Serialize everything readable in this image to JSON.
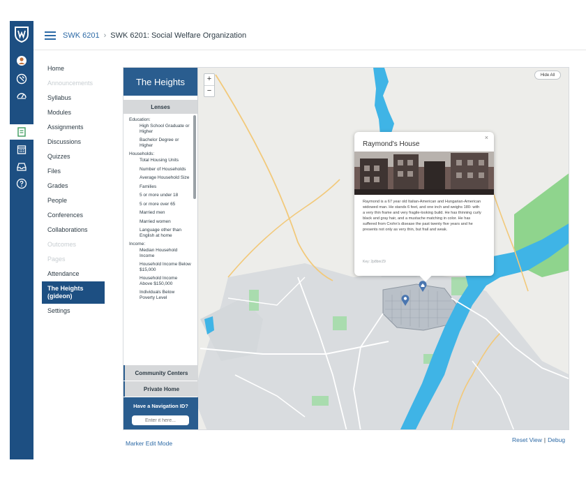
{
  "colors": {
    "brand_blue": "#1d4f82",
    "panel_blue": "#2a5d8f",
    "link_blue": "#2d6aa6",
    "water": "#3fb4e6",
    "park_green": "#8fd48d",
    "pin_blue": "#4a76b0"
  },
  "global_nav": {
    "icons": [
      "university-shield-logo",
      "account-icon",
      "admin-icon",
      "dashboard-icon",
      "courses-icon",
      "calendar-icon",
      "inbox-icon",
      "help-icon"
    ]
  },
  "header": {
    "course_code": "SWK 6201",
    "separator": "›",
    "page_title": "SWK 6201: Social Welfare Organization"
  },
  "course_nav": {
    "items": [
      {
        "label": "Home",
        "state": "normal"
      },
      {
        "label": "Announcements",
        "state": "muted"
      },
      {
        "label": "Syllabus",
        "state": "normal"
      },
      {
        "label": "Modules",
        "state": "normal"
      },
      {
        "label": "Assignments",
        "state": "normal"
      },
      {
        "label": "Discussions",
        "state": "normal"
      },
      {
        "label": "Quizzes",
        "state": "normal"
      },
      {
        "label": "Files",
        "state": "normal"
      },
      {
        "label": "Grades",
        "state": "normal"
      },
      {
        "label": "People",
        "state": "normal"
      },
      {
        "label": "Conferences",
        "state": "normal"
      },
      {
        "label": "Collaborations",
        "state": "normal"
      },
      {
        "label": "Outcomes",
        "state": "muted"
      },
      {
        "label": "Pages",
        "state": "muted"
      },
      {
        "label": "Attendance",
        "state": "normal"
      },
      {
        "label": "The Heights (gideon)",
        "state": "active"
      },
      {
        "label": "Settings",
        "state": "normal"
      }
    ]
  },
  "panel": {
    "title": "The Heights",
    "lenses_label": "Lenses",
    "lenses": [
      {
        "category": "Education:",
        "items": [
          "High School Graduate or Higher",
          "Bachelor Degree or Higher"
        ]
      },
      {
        "category": "Households:",
        "items": [
          "Total Housing Units",
          "Number of Households",
          "Average Household Size",
          "Families",
          "5 or more under 18",
          "5 or more over 65",
          "Married men",
          "Married women",
          "Language other than English at home"
        ]
      },
      {
        "category": "Income:",
        "items": [
          "Median Household Income",
          "Household Income Below $15,000",
          "Household Income Above $150,000",
          "Individuals Below Poverty Level"
        ]
      }
    ],
    "buttons": {
      "community_centers": "Community Centers",
      "private_home": "Private Home"
    },
    "nav_id_label": "Have a Navigation ID?",
    "nav_id_placeholder": "Enter it here..."
  },
  "map": {
    "zoom_in": "+",
    "zoom_out": "−",
    "hide_all": "Hide All"
  },
  "popup": {
    "title": "Raymond's House",
    "close": "×",
    "body": "Raymond is a 67 year old Italian-American and Hungarian-American widowed man. He stands 6 feet, and one inch and weighs 180- with a very thin frame and very fragile-looking build. He has thinning curly black and gray hair, and a mustache matching in color. He has suffered from Crohn's disease the past twenty five years and he presents not only as very thin, but frail and weak.",
    "key": "Key: 2p8bnrZ9"
  },
  "footer": {
    "marker_edit": "Marker Edit Mode",
    "reset_view": "Reset View",
    "separator": "|",
    "debug": "Debug"
  }
}
